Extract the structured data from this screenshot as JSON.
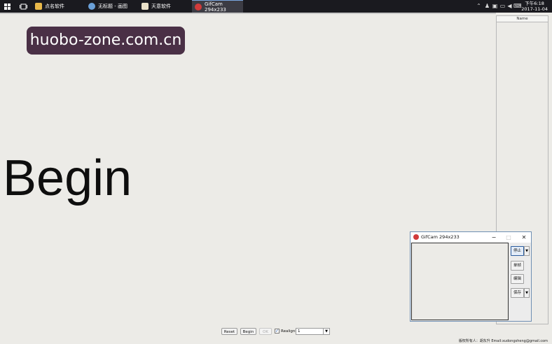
{
  "taskbar": {
    "tasks": [
      {
        "label": "点名软件",
        "icon": "folder-icon",
        "color": "#e8b84a"
      },
      {
        "label": "无标题 - 画图",
        "icon": "paint-icon",
        "color": "#6aa0d8"
      },
      {
        "label": "天意软件",
        "icon": "app-icon",
        "color": "#e9e0c8"
      },
      {
        "label": "GifCam 294x233",
        "icon": "gifcam-icon",
        "color": "#d13b3b"
      }
    ],
    "clock_time": "下午6:18",
    "clock_date": "2017-11-04"
  },
  "watermark": "huobo-zone.com.cn",
  "main_label": "Begin",
  "side_panel": {
    "header": "Name"
  },
  "toolbar": {
    "reset_label": "Reset",
    "begin_label": "Begin",
    "ok_label": "OK",
    "checkbox_label": "Realignble",
    "checkbox_checked": true,
    "select_value": "1"
  },
  "footer": "版权所有人：胡东升   Email:xudongsheng@gmail.com",
  "gifcam": {
    "title": "GifCam 294x233",
    "buttons": {
      "stop": "停止",
      "single_frame": "单帧",
      "edit": "编辑",
      "save": "保存"
    }
  },
  "colors": {
    "brand_bg": "#4a3046",
    "taskbar_bg": "#1a1a1f",
    "gifcam_accent": "#d13b3b"
  }
}
